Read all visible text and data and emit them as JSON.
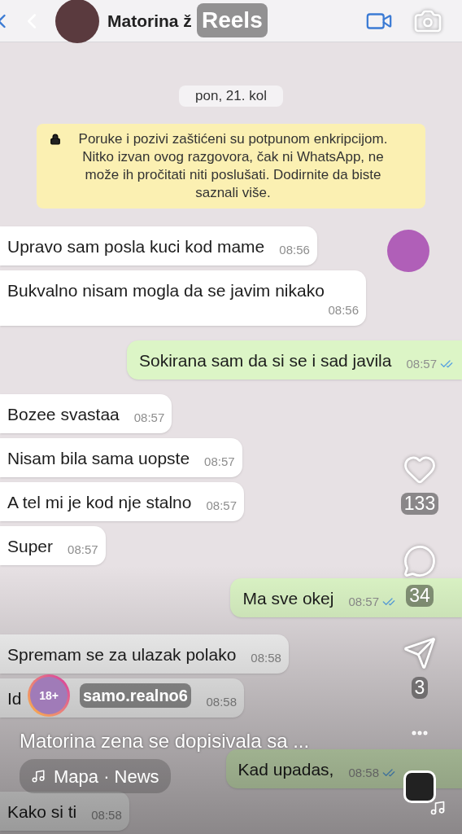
{
  "reels_header": {
    "title": "Reels"
  },
  "chat": {
    "contact_name": "Matorina ž",
    "date": "pon, 21. kol",
    "encryption_notice": "Poruke i pozivi zaštićeni su potpunom enkripcijom. Nitko izvan ovog razgovora, čak ni WhatsApp, ne može ih pročitati niti poslušati. Dodirnite da biste saznali više.",
    "messages": [
      {
        "kind": "in",
        "text": "Upravo sam posla kuci kod mame",
        "time": "08:56"
      },
      {
        "kind": "in",
        "text": "Bukvalno nisam mogla da se javim nikako",
        "time": "08:56"
      },
      {
        "kind": "out",
        "text": "Sokirana sam da si se i sad javila",
        "time": "08:57"
      },
      {
        "kind": "in",
        "text": "Bozee svastaa",
        "time": "08:57"
      },
      {
        "kind": "in",
        "text": "Nisam bila sama uopste",
        "time": "08:57"
      },
      {
        "kind": "in",
        "text": "A tel mi je kod nje stalno",
        "time": "08:57"
      },
      {
        "kind": "in",
        "text": "Super",
        "time": "08:57"
      },
      {
        "kind": "out",
        "text": "Ma sve okej",
        "time": "08:57"
      },
      {
        "kind": "in",
        "text": "Spremam se za ulazak polako",
        "time": "08:58"
      },
      {
        "kind": "in",
        "text": "Id",
        "time": "08:58"
      },
      {
        "kind": "out",
        "text": "Kad upadas,",
        "time": "08:58"
      },
      {
        "kind": "in",
        "text": "Kako si ti",
        "time": "08:58"
      }
    ]
  },
  "actions": [
    {
      "kind": "like",
      "count": "133"
    },
    {
      "kind": "comment",
      "count": "34"
    },
    {
      "kind": "share",
      "count": "3"
    }
  ],
  "post": {
    "username": "samo.realno6",
    "avatar_badge": "18+",
    "caption": "Matorina zena se dopisivala sa ...",
    "audio": "Mapa · News"
  }
}
